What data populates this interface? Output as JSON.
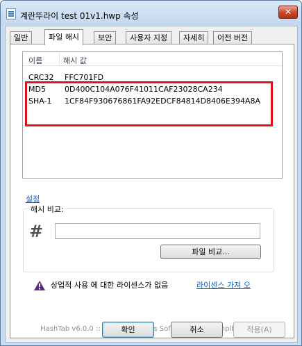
{
  "window": {
    "title": "계란뚜라이 test 01v1.hwp 속성",
    "close_label": "✕"
  },
  "tabs": [
    {
      "label": "일반"
    },
    {
      "label": "파일 해시"
    },
    {
      "label": "보안"
    },
    {
      "label": "사용자 지정"
    },
    {
      "label": "자세히"
    },
    {
      "label": "이전 버전"
    }
  ],
  "hash_list": {
    "columns": [
      "이름",
      "해시 값"
    ],
    "rows": [
      {
        "name": "CRC32",
        "value": "FFC701FD"
      },
      {
        "name": "MD5",
        "value": "0D400C104A076F41011CAF23028CA234"
      },
      {
        "name": "SHA-1",
        "value": "1CF84F930676861FA92EDCF84814D8406E394A8A"
      }
    ]
  },
  "settings_link": "설정",
  "hash_compare": {
    "label": "해시 비교:",
    "input_value": "",
    "compare_button": "파일 비교..."
  },
  "license": {
    "warning_text": "상업적 사용 에 대한 라이센스가 없음",
    "link_text": "라이센스 가져 오"
  },
  "footer": "HashTab v6.0.0 :: ©2016 Implbits Software [http://implbits.com]",
  "buttons": {
    "ok": "확인",
    "cancel": "취소",
    "apply": "적용(A)"
  },
  "colors": {
    "highlight": "#e0141f",
    "link": "#0c64c6",
    "warning_icon": "#5b2a86"
  }
}
